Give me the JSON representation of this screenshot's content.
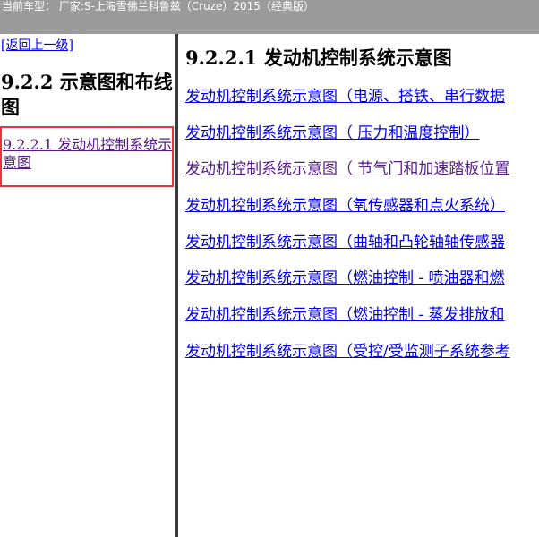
{
  "header": {
    "vehicle_info": "当前车型： 厂家:S-上海雪佛兰科鲁兹（Cruze）2015（经典版）"
  },
  "sidebar": {
    "back_link": "[返回上一级]",
    "section_title": "9.2.2 示意图和布线图",
    "items": [
      {
        "label": "9.2.2.1 发动机控制系统示意图",
        "selected": true
      }
    ]
  },
  "main": {
    "title": "9.2.2.1 发动机控制系统示意图",
    "links": [
      "发动机控制系统示意图（电源、搭铁、串行数据",
      "发动机控制系统示意图（ 压力和温度控制）",
      "发动机控制系统示意图（ 节气门和加速踏板位置",
      "发动机控制系统示意图（氧传感器和点火系统）",
      "发动机控制系统示意图（曲轴和凸轮轴轴传感器",
      "发动机控制系统示意图（燃油控制 - 喷油器和燃",
      "发动机控制系统示意图（燃油控制 - 蒸发排放和",
      "发动机控制系统示意图（受控/受监测子系统参考"
    ],
    "visited_index": 2
  },
  "colors": {
    "link": "#0000ee",
    "visited_link": "#551a8b",
    "selection_border": "#e0383b",
    "header_bg": "#9b9b9b",
    "divider": "#3a3a3a"
  }
}
